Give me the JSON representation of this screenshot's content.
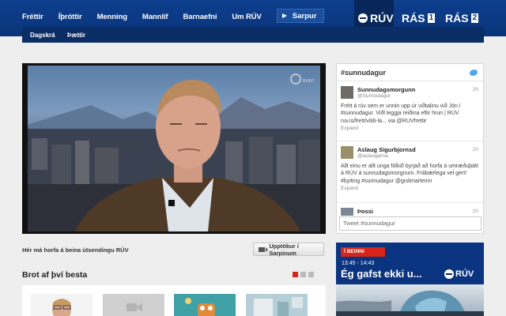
{
  "nav": {
    "items": [
      "Fréttir",
      "Íþróttir",
      "Menning",
      "Mannlíf",
      "Barnaefni",
      "Um RÚV"
    ],
    "sarpur_label": "Sarpur"
  },
  "brands": {
    "ruv": "RÚV",
    "ras": "RÁS",
    "ras1_num": "1",
    "ras2_num": "2"
  },
  "subnav": [
    "Dagskrá",
    "Þættir"
  ],
  "video": {
    "caption": "Hér má horfa á beina útsendingu RÚV",
    "button": "Upptökur í Sarpinum"
  },
  "brot": {
    "title": "Brot af því besta"
  },
  "twitter": {
    "hashtag": "#sunnudagur",
    "tweets": [
      {
        "name": "Sunnudagsmorgunn",
        "handle": "@Sunnudagur",
        "time": "2h",
        "text": "Frétt á rúv sem er unnin upp úr viðtalinu við Jón í #sunnudagur. Viðl leggja reiðina eftir hrun | RÚV ruv.is/frett/vildi-la... via @RUVfrettir",
        "expand": "Expand"
      },
      {
        "name": "Aslaug Sigurbjornsd",
        "handle": "@aslaugarna",
        "time": "2h",
        "text": "Allt einu er allt unga fólkið byrjað að horfa á umræðuþátt á RÚV á sunnudagsmorgnum. Frábærlega vel gert! #byiting #sunnudagur @gislimarteinn",
        "expand": "Expand"
      },
      {
        "name": "Þossi",
        "handle": "",
        "time": "2h",
        "text": "",
        "expand": ""
      }
    ],
    "input_placeholder": "Tweet #sunnudagur"
  },
  "promo": {
    "badge": "Í BEINNI",
    "time": "13:45 - 14:43",
    "title": "Ég gafst ekki u...",
    "logo": "RÚV"
  }
}
